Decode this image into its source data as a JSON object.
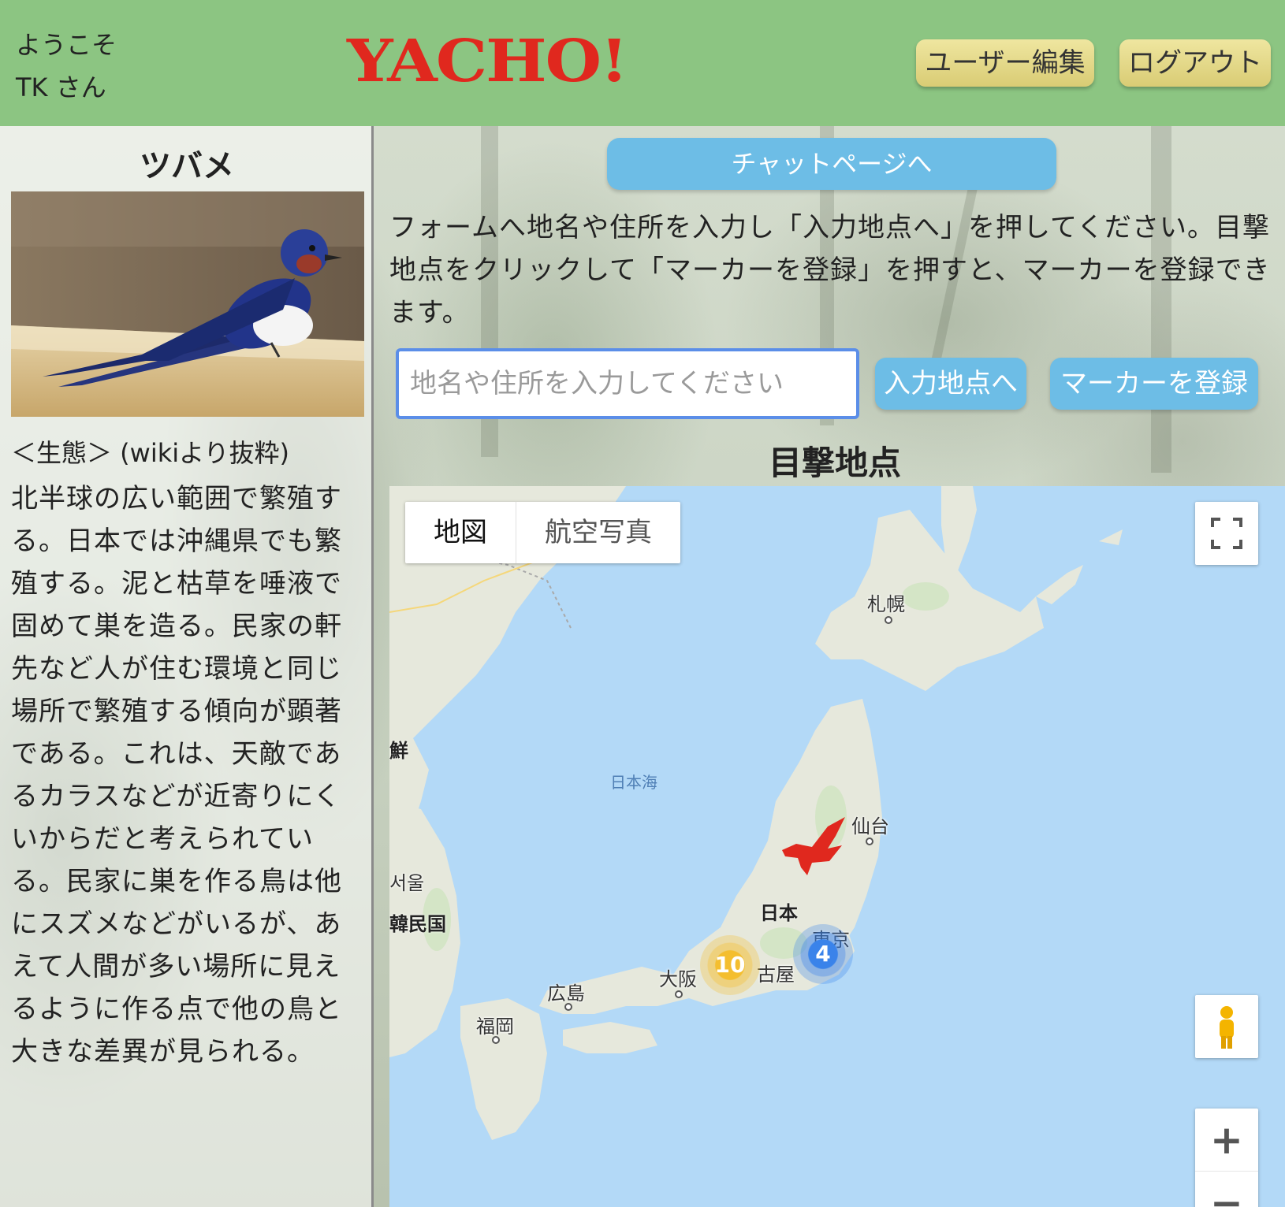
{
  "header": {
    "welcome_line1": "ようこそ",
    "welcome_line2": "TK さん",
    "logo": "YACHO!",
    "edit_user_label": "ユーザー編集",
    "logout_label": "ログアウト"
  },
  "bird": {
    "name": "ツバメ",
    "ecology_heading": "＜生態＞ (wikiより抜粋)",
    "ecology_text": "北半球の広い範囲で繁殖する。日本では沖縄県でも繁殖する。泥と枯草を唾液で固めて巣を造る。民家の軒先など人が住む環境と同じ場所で繁殖する傾向が顕著である。これは、天敵であるカラスなどが近寄りにくいからだと考えられている。民家に巣を作る鳥は他にスズメなどがいるが、あえて人間が多い場所に見えるように作る点で他の鳥と大きな差異が見られる。"
  },
  "main": {
    "chat_button": "チャットページへ",
    "instruction": "フォームへ地名や住所を入力し「入力地点へ」を押してください。目撃地点をクリックして「マーカーを登録」を押すと、マーカーを登録できます。",
    "search_placeholder": "地名や住所を入力してください",
    "goto_button": "入力地点へ",
    "register_button": "マーカーを登録",
    "map_title": "目撃地点"
  },
  "map": {
    "type_map": "地図",
    "type_satellite": "航空写真",
    "zoom_in": "+",
    "zoom_out": "−",
    "cities": {
      "sapporo": "札幌",
      "sendai": "仙台",
      "tokyo": "東京",
      "nagoya": "古屋",
      "osaka": "大阪",
      "hiroshima": "広島",
      "fukuoka": "福岡"
    },
    "sea_name": "日本海",
    "country_japan": "日本",
    "country_korea": "韓民国",
    "seoul": "서울",
    "nk_fragment": "鮮",
    "clusters": {
      "yellow_count": "10",
      "blue_count": "4"
    },
    "icons": [
      "fullscreen-icon",
      "pegman-icon",
      "bird-marker-icon"
    ]
  },
  "colors": {
    "header_bg": "#8cc582",
    "logo": "#e0281e",
    "accent_button": "#6dbde6",
    "header_button": "#e6da86",
    "sea": "#b3d9f7",
    "land": "#e8eadf"
  }
}
